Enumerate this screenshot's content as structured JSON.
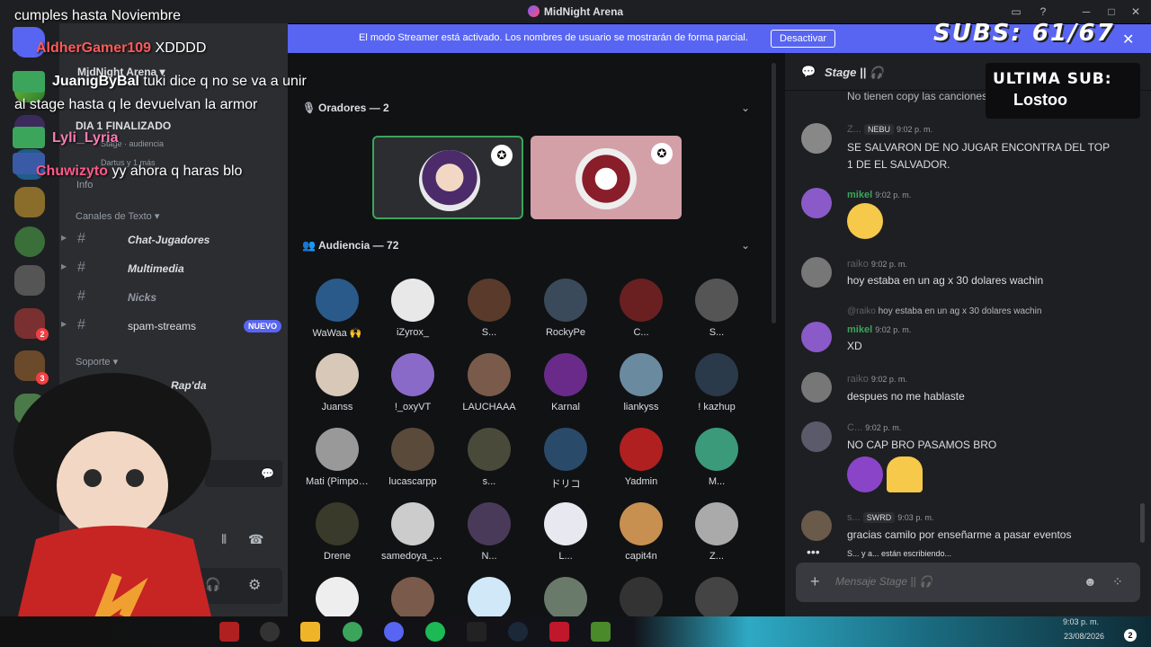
{
  "window": {
    "title": "MidNight Arena",
    "controls": [
      "inbox-icon",
      "help-icon",
      "minimize-icon",
      "maximize-icon",
      "close-icon"
    ]
  },
  "banner": {
    "text": "El modo Streamer está activado. Los nombres de usuario se mostrarán de forma parcial.",
    "button": "Desactivar"
  },
  "overlay": {
    "subs": "SUBS: 61/67",
    "ultima_label": "ULTIMA SUB:",
    "ultima_name": "Lostoo",
    "stream_chat": [
      {
        "user": "",
        "text": "cumples hasta Noviembre"
      },
      {
        "user": "AldherGamer109",
        "text": "XDDDD"
      },
      {
        "user": "JuanigByBal",
        "text": "tuki dice q no se va a unir"
      },
      {
        "user": "",
        "text": "al stage hasta q le devuelvan la armor"
      },
      {
        "user": "Lyli_Lyria",
        "text": ""
      },
      {
        "user": "Chuwizyto",
        "text": "yy ahora q haras blo"
      }
    ]
  },
  "sidebar": {
    "server_name": "MidNight Arena",
    "event_title": "DIA 1 FINALIZADO",
    "stage_label": "Stage",
    "audience_word": "audiencia",
    "listeners": "Dartus y 1 más",
    "info": "Info",
    "category_text": "Canales de Texto",
    "channels": [
      {
        "name": "Chat-Jugadores"
      },
      {
        "name": "Multimedia"
      },
      {
        "name": "Nicks"
      },
      {
        "name": "spam-streams",
        "badge": "NUEVO"
      }
    ],
    "category_support": "Soporte",
    "support_item": "Rap'da",
    "server_badges": [
      "2",
      "3"
    ]
  },
  "stage": {
    "speakers_header": "Oradores — 2",
    "audience_header": "Audiencia — 72",
    "audience": [
      "WaWaa 🙌",
      "iZyrox_",
      "S...",
      "RockyPe",
      "C...",
      "S...",
      "Juanss",
      "!_oxyVT",
      "LAUCHAAA",
      "Karnal",
      "liankyss",
      "! kazhup",
      "Mati (Pimpollo)",
      "lucascarpp",
      "s...",
      "ドリコ",
      "Yadmin",
      "M...",
      "Drene",
      "samedoya_x2...",
      "N...",
      "L...",
      "capit4n",
      "Z..."
    ]
  },
  "chat": {
    "channel": "Stage || 🎧",
    "messages": [
      {
        "name": "",
        "text": "No tienen copy las canciones"
      },
      {
        "name": "Z...",
        "tag": "NEBU",
        "time": "9:02 p. m.",
        "text": "SE SALVARON DE NO JUGAR ENCONTRA DEL TOP 1 DE EL SALVADOR."
      },
      {
        "name": "mikel",
        "time": "9:02 p. m.",
        "text": ""
      },
      {
        "name": "raiko",
        "time": "9:02 p. m.",
        "text": "hoy estaba en un ag x 30 dolares wachin"
      },
      {
        "name": "mikel",
        "time": "9:02 p. m.",
        "reply": "hoy estaba en un ag x 30 dolares wachin",
        "reply_name": "@raiko",
        "text": "XD"
      },
      {
        "name": "raiko",
        "time": "9:02 p. m.",
        "text": "despues no me hablaste"
      },
      {
        "name": "C...",
        "time": "9:02 p. m.",
        "text": "NO CAP BRO PASAMOS BRO"
      },
      {
        "name": "s...",
        "tag": "SWRD",
        "time": "9:03 p. m.",
        "text": "gracias camilo por enseñarme a pasar eventos"
      }
    ],
    "typing": "S... y a... están escribiendo...",
    "composer_placeholder": "Mensaje Stage || 🎧"
  },
  "taskbar": {
    "time": "9:03 p. m.",
    "date": "23/08/2026",
    "notif_count": "2"
  },
  "colors": {
    "accent": "#5865f2",
    "bg_dark": "#111214",
    "chat_bg": "#1e1f22",
    "green_name": "#3ba55c"
  }
}
